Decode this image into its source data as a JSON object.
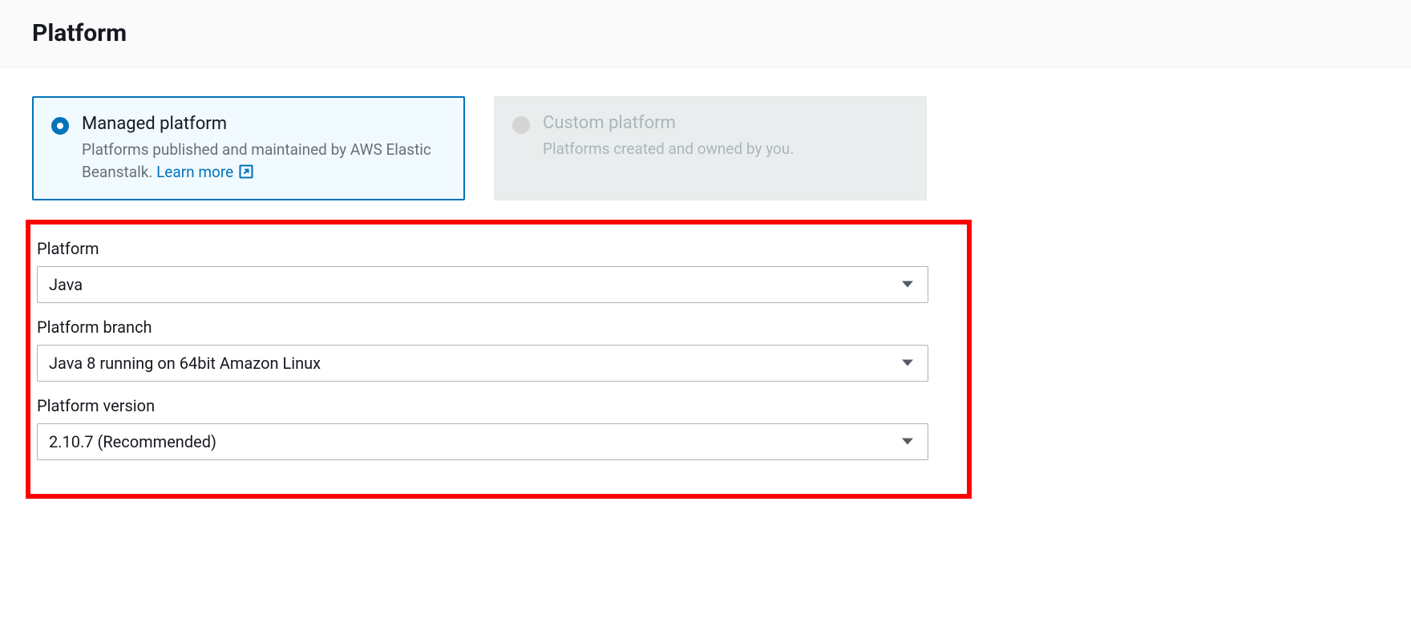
{
  "header": {
    "title": "Platform"
  },
  "tiles": {
    "managed": {
      "title": "Managed platform",
      "desc_prefix": "Platforms published and maintained by AWS Elastic Beanstalk. ",
      "learn_more": "Learn more"
    },
    "custom": {
      "title": "Custom platform",
      "desc": "Platforms created and owned by you."
    }
  },
  "form": {
    "platform": {
      "label": "Platform",
      "value": "Java"
    },
    "branch": {
      "label": "Platform branch",
      "value": "Java 8 running on 64bit Amazon Linux"
    },
    "version": {
      "label": "Platform version",
      "value": "2.10.7 (Recommended)"
    }
  }
}
